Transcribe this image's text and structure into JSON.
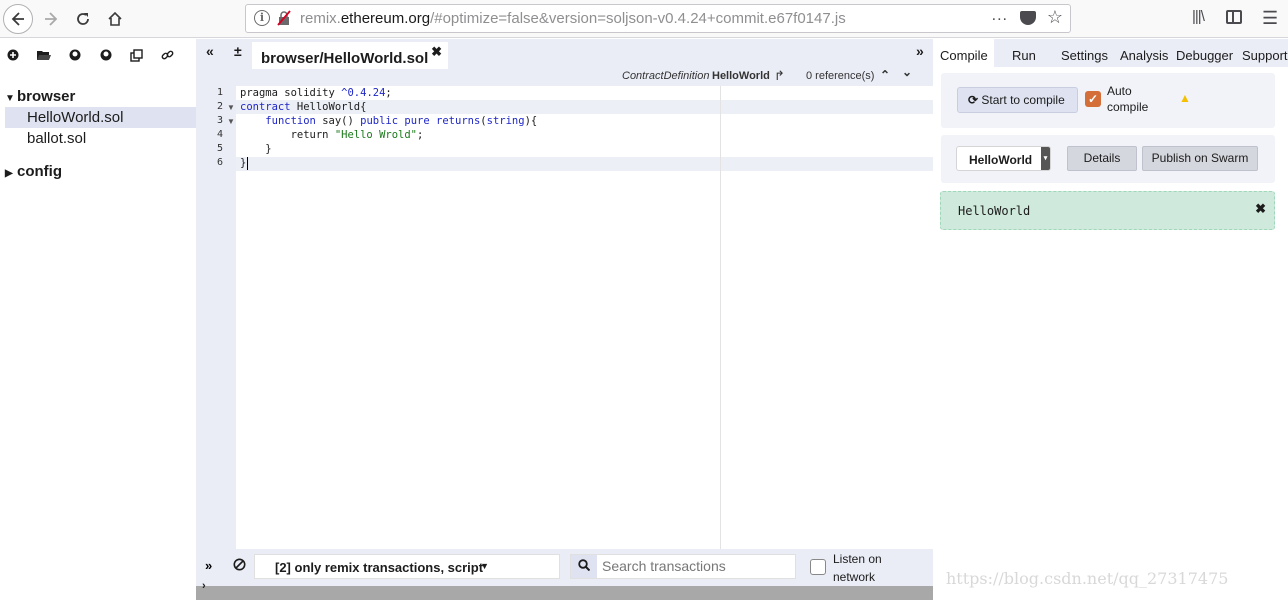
{
  "browser": {
    "url_prefix": "remix.",
    "url_domain": "ethereum.org",
    "url_rest": "/#optimize=false&version=soljson-v0.4.24+commit.e67f0147.js",
    "more_icon": "...",
    "star_icon": "star-icon"
  },
  "file_explorer": {
    "folders": [
      {
        "label": "browser",
        "expanded": true
      },
      {
        "label": "config",
        "expanded": false
      }
    ],
    "files": [
      {
        "label": "HelloWorld.sol",
        "selected": true
      },
      {
        "label": "ballot.sol",
        "selected": false
      }
    ]
  },
  "editor": {
    "active_tab": "browser/HelloWorld.sol",
    "context": {
      "kind": "ContractDefinition",
      "name": "HelloWorld",
      "references": "0 reference(s)"
    },
    "line_numbers": [
      "1",
      "2",
      "3",
      "4",
      "5",
      "6"
    ],
    "code": [
      [
        {
          "t": "pragma solidity ",
          "c": ""
        },
        {
          "t": "^0.4.24",
          "c": "num"
        },
        {
          "t": ";",
          "c": ""
        }
      ],
      [
        {
          "t": "contract",
          "c": "kw"
        },
        {
          "t": " HelloWorld{",
          "c": ""
        }
      ],
      [
        {
          "t": "    ",
          "c": ""
        },
        {
          "t": "function",
          "c": "kw"
        },
        {
          "t": " say() ",
          "c": ""
        },
        {
          "t": "public",
          "c": "kw"
        },
        {
          "t": " ",
          "c": ""
        },
        {
          "t": "pure",
          "c": "kw"
        },
        {
          "t": " ",
          "c": ""
        },
        {
          "t": "returns",
          "c": "kw"
        },
        {
          "t": "(",
          "c": ""
        },
        {
          "t": "string",
          "c": "kw"
        },
        {
          "t": "){",
          "c": ""
        }
      ],
      [
        {
          "t": "        return ",
          "c": ""
        },
        {
          "t": "\"Hello Wrold\"",
          "c": "str"
        },
        {
          "t": ";",
          "c": ""
        }
      ],
      [
        {
          "t": "    }",
          "c": ""
        }
      ],
      [
        {
          "t": "}",
          "c": ""
        }
      ]
    ]
  },
  "terminal": {
    "filter": "[2] only remix transactions, script",
    "search_placeholder": "Search transactions",
    "listen_label": "Listen on network"
  },
  "right_panel": {
    "tabs": [
      "Compile",
      "Run",
      "Settings",
      "Analysis",
      "Debugger",
      "Support"
    ],
    "active_tab": "Compile",
    "compile_button": "Start to compile",
    "auto_compile_label": "Auto compile",
    "auto_compile_checked": true,
    "contract_select": "HelloWorld",
    "details_button": "Details",
    "publish_button": "Publish on Swarm",
    "result_contract": "HelloWorld"
  },
  "watermark": "https://blog.csdn.net/qq_27317475",
  "colors": {
    "panel_bg": "#eaedf6",
    "accent_checkbox": "#d46f3a",
    "result_bg": "#cfeadc",
    "keyword": "#1f27c8",
    "string": "#1a7a1a"
  }
}
